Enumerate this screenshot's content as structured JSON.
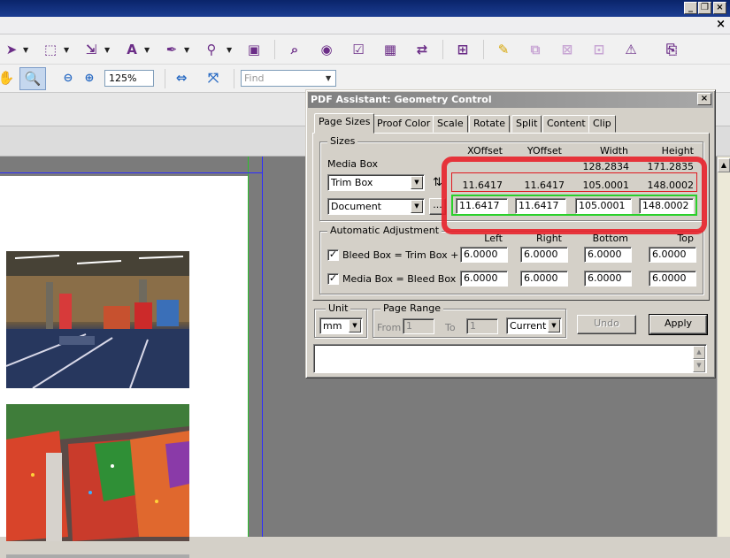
{
  "toolbar": {
    "zoom_value": "125%",
    "find_placeholder": "Find"
  },
  "dialog": {
    "title": "PDF Assistant: Geometry Control",
    "tabs": [
      {
        "label": "Page Sizes"
      },
      {
        "label": "Proof Color"
      },
      {
        "label": "Scale"
      },
      {
        "label": "Rotate"
      },
      {
        "label": "Split"
      },
      {
        "label": "Content"
      },
      {
        "label": "Clip"
      }
    ],
    "sizes": {
      "group_label": "Sizes",
      "headers": {
        "xoffset": "XOffset",
        "yoffset": "YOffset",
        "width": "Width",
        "height": "Height"
      },
      "media_box": {
        "label": "Media Box",
        "width": "128.2834",
        "height": "171.2835"
      },
      "trim_row": {
        "select": "Trim Box",
        "xoffset": "11.6417",
        "yoffset": "11.6417",
        "width": "105.0001",
        "height": "148.0002"
      },
      "doc_row": {
        "select": "Document",
        "more": "...",
        "xoffset": "11.6417",
        "yoffset": "11.6417",
        "width": "105.0001",
        "height": "148.0002"
      }
    },
    "auto_adjust": {
      "group_label": "Automatic Adjustment",
      "headers": {
        "left": "Left",
        "right": "Right",
        "bottom": "Bottom",
        "top": "Top"
      },
      "rows": [
        {
          "label": "Bleed Box = Trim Box +",
          "checked": true,
          "left": "6.0000",
          "right": "6.0000",
          "bottom": "6.0000",
          "top": "6.0000"
        },
        {
          "label": "Media Box = Bleed Box +",
          "checked": true,
          "left": "6.0000",
          "right": "6.0000",
          "bottom": "6.0000",
          "top": "6.0000"
        }
      ]
    },
    "unit": {
      "group_label": "Unit",
      "value": "mm"
    },
    "page_range": {
      "group_label": "Page Range",
      "from_label": "From",
      "from_value": "1",
      "to_label": "To",
      "to_value": "1",
      "mode": "Current"
    },
    "buttons": {
      "undo": "Undo",
      "apply": "Apply"
    },
    "colors": {
      "highlight_red": "#e8212a",
      "highlight_green": "#2ad02a",
      "trim_line": "#2c2cff"
    }
  }
}
